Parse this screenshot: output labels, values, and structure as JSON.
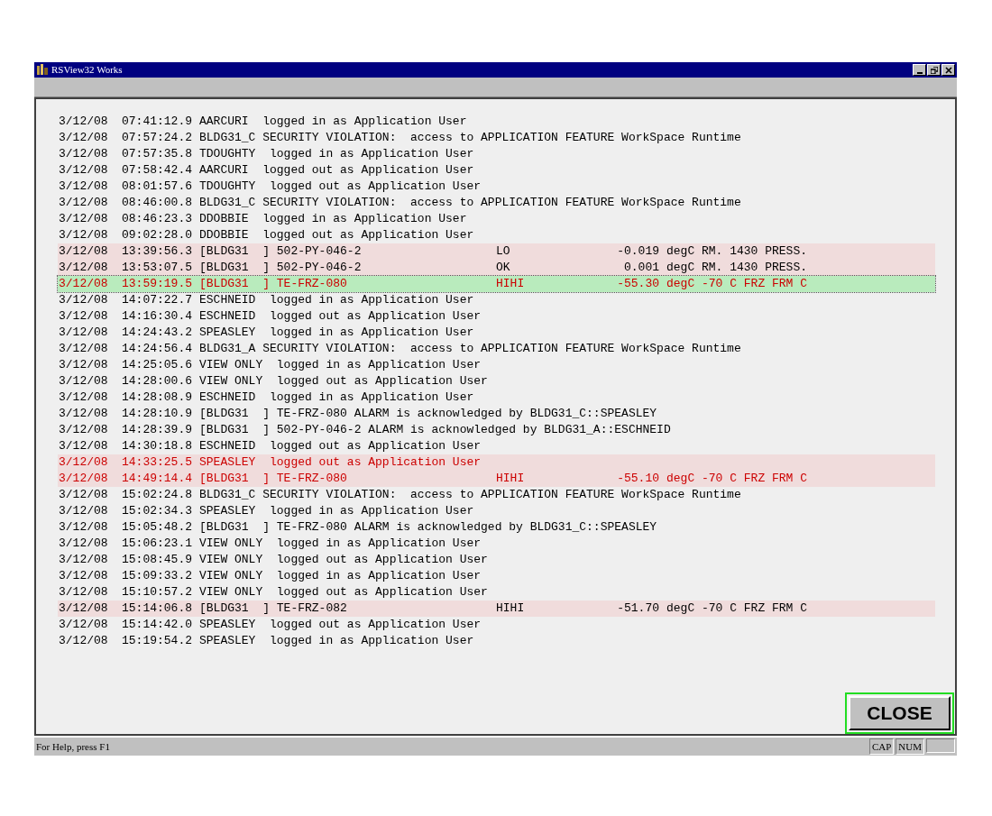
{
  "window": {
    "title": "RSView32 Works"
  },
  "log": {
    "rows": [
      {
        "kind": "event",
        "date": "3/12/08",
        "time": "07:41:12.9",
        "message": "AARCURI  logged in as Application User",
        "color": "#000000",
        "highlighted": false,
        "selected": false
      },
      {
        "kind": "event",
        "date": "3/12/08",
        "time": "07:57:24.2",
        "message": "BLDG31_C SECURITY VIOLATION:  access to APPLICATION FEATURE WorkSpace Runtime",
        "color": "#000000",
        "highlighted": false,
        "selected": false
      },
      {
        "kind": "event",
        "date": "3/12/08",
        "time": "07:57:35.8",
        "message": "TDOUGHTY  logged in as Application User",
        "color": "#000000",
        "highlighted": false,
        "selected": false
      },
      {
        "kind": "event",
        "date": "3/12/08",
        "time": "07:58:42.4",
        "message": "AARCURI  logged out as Application User",
        "color": "#000000",
        "highlighted": false,
        "selected": false
      },
      {
        "kind": "event",
        "date": "3/12/08",
        "time": "08:01:57.6",
        "message": "TDOUGHTY  logged out as Application User",
        "color": "#000000",
        "highlighted": false,
        "selected": false
      },
      {
        "kind": "event",
        "date": "3/12/08",
        "time": "08:46:00.8",
        "message": "BLDG31_C SECURITY VIOLATION:  access to APPLICATION FEATURE WorkSpace Runtime",
        "color": "#000000",
        "highlighted": false,
        "selected": false
      },
      {
        "kind": "event",
        "date": "3/12/08",
        "time": "08:46:23.3",
        "message": "DDOBBIE  logged in as Application User",
        "color": "#000000",
        "highlighted": false,
        "selected": false
      },
      {
        "kind": "event",
        "date": "3/12/08",
        "time": "09:02:28.0",
        "message": "DDOBBIE  logged out as Application User",
        "color": "#000000",
        "highlighted": false,
        "selected": false
      },
      {
        "kind": "alarm",
        "date": "3/12/08",
        "time": "13:39:56.3",
        "message": "[BLDG31  ] 502-PY-046-2",
        "state": "LO",
        "reading": "-0.019",
        "description": "degC RM. 1430 PRESS.",
        "color": "#000000",
        "highlighted": true,
        "selected": false
      },
      {
        "kind": "alarm",
        "date": "3/12/08",
        "time": "13:53:07.5",
        "message": "[BLDG31  ] 502-PY-046-2",
        "state": "OK",
        "reading": "0.001",
        "description": "degC RM. 1430 PRESS.",
        "color": "#000000",
        "highlighted": true,
        "selected": false
      },
      {
        "kind": "alarm",
        "date": "3/12/08",
        "time": "13:59:19.5",
        "message": "[BLDG31  ] TE-FRZ-080",
        "state": "HIHI",
        "reading": "-55.30",
        "description": "degC -70 C FRZ FRM C",
        "color": "#cc0000",
        "selected": true
      },
      {
        "kind": "event",
        "date": "3/12/08",
        "time": "14:07:22.7",
        "message": "ESCHNEID  logged in as Application User",
        "color": "#000000",
        "highlighted": false,
        "selected": false
      },
      {
        "kind": "event",
        "date": "3/12/08",
        "time": "14:16:30.4",
        "message": "ESCHNEID  logged out as Application User",
        "color": "#000000",
        "highlighted": false,
        "selected": false
      },
      {
        "kind": "event",
        "date": "3/12/08",
        "time": "14:24:43.2",
        "message": "SPEASLEY  logged in as Application User",
        "color": "#000000",
        "highlighted": false,
        "selected": false
      },
      {
        "kind": "event",
        "date": "3/12/08",
        "time": "14:24:56.4",
        "message": "BLDG31_A SECURITY VIOLATION:  access to APPLICATION FEATURE WorkSpace Runtime",
        "color": "#000000",
        "highlighted": false,
        "selected": false
      },
      {
        "kind": "event",
        "date": "3/12/08",
        "time": "14:25:05.6",
        "message": "VIEW ONLY  logged in as Application User",
        "color": "#000000",
        "highlighted": false,
        "selected": false
      },
      {
        "kind": "event",
        "date": "3/12/08",
        "time": "14:28:00.6",
        "message": "VIEW ONLY  logged out as Application User",
        "color": "#000000",
        "highlighted": false,
        "selected": false
      },
      {
        "kind": "event",
        "date": "3/12/08",
        "time": "14:28:08.9",
        "message": "ESCHNEID  logged in as Application User",
        "color": "#000000",
        "highlighted": false,
        "selected": false
      },
      {
        "kind": "event",
        "date": "3/12/08",
        "time": "14:28:10.9",
        "message": "[BLDG31  ] TE-FRZ-080 ALARM is acknowledged by BLDG31_C::SPEASLEY",
        "color": "#000000",
        "highlighted": false,
        "selected": false
      },
      {
        "kind": "event",
        "date": "3/12/08",
        "time": "14:28:39.9",
        "message": "[BLDG31  ] 502-PY-046-2 ALARM is acknowledged by BLDG31_A::ESCHNEID",
        "color": "#000000",
        "highlighted": false,
        "selected": false
      },
      {
        "kind": "event",
        "date": "3/12/08",
        "time": "14:30:18.8",
        "message": "ESCHNEID  logged out as Application User",
        "color": "#000000",
        "highlighted": false,
        "selected": false
      },
      {
        "kind": "event",
        "date": "3/12/08",
        "time": "14:33:25.5",
        "message": "SPEASLEY  logged out as Application User",
        "color": "#cc0000",
        "highlighted": true,
        "selected": false
      },
      {
        "kind": "alarm",
        "date": "3/12/08",
        "time": "14:49:14.4",
        "message": "[BLDG31  ] TE-FRZ-080",
        "state": "HIHI",
        "reading": "-55.10",
        "description": "degC -70 C FRZ FRM C",
        "color": "#cc0000",
        "highlighted": true,
        "selected": false
      },
      {
        "kind": "event",
        "date": "3/12/08",
        "time": "15:02:24.8",
        "message": "BLDG31_C SECURITY VIOLATION:  access to APPLICATION FEATURE WorkSpace Runtime",
        "color": "#000000",
        "highlighted": false,
        "selected": false
      },
      {
        "kind": "event",
        "date": "3/12/08",
        "time": "15:02:34.3",
        "message": "SPEASLEY  logged in as Application User",
        "color": "#000000",
        "highlighted": false,
        "selected": false
      },
      {
        "kind": "event",
        "date": "3/12/08",
        "time": "15:05:48.2",
        "message": "[BLDG31  ] TE-FRZ-080 ALARM is acknowledged by BLDG31_C::SPEASLEY",
        "color": "#000000",
        "highlighted": false,
        "selected": false
      },
      {
        "kind": "event",
        "date": "3/12/08",
        "time": "15:06:23.1",
        "message": "VIEW ONLY  logged in as Application User",
        "color": "#000000",
        "highlighted": false,
        "selected": false
      },
      {
        "kind": "event",
        "date": "3/12/08",
        "time": "15:08:45.9",
        "message": "VIEW ONLY  logged out as Application User",
        "color": "#000000",
        "highlighted": false,
        "selected": false
      },
      {
        "kind": "event",
        "date": "3/12/08",
        "time": "15:09:33.2",
        "message": "VIEW ONLY  logged in as Application User",
        "color": "#000000",
        "highlighted": false,
        "selected": false
      },
      {
        "kind": "event",
        "date": "3/12/08",
        "time": "15:10:57.2",
        "message": "VIEW ONLY  logged out as Application User",
        "color": "#000000",
        "highlighted": false,
        "selected": false
      },
      {
        "kind": "alarm",
        "date": "3/12/08",
        "time": "15:14:06.8",
        "message": "[BLDG31  ] TE-FRZ-082",
        "state": "HIHI",
        "reading": "-51.70",
        "description": "degC -70 C FRZ FRM C",
        "color": "#000000",
        "highlighted": true,
        "selected": false
      },
      {
        "kind": "event",
        "date": "3/12/08",
        "time": "15:14:42.0",
        "message": "SPEASLEY  logged out as Application User",
        "color": "#000000",
        "highlighted": false,
        "selected": false
      },
      {
        "kind": "event",
        "date": "3/12/08",
        "time": "15:19:54.2",
        "message": "SPEASLEY  logged in as Application User",
        "color": "#000000",
        "highlighted": false,
        "selected": false
      }
    ]
  },
  "close_button": {
    "label": "CLOSE"
  },
  "status_bar": {
    "help": "For Help, press F1",
    "panes": [
      "CAP",
      "NUM"
    ]
  }
}
